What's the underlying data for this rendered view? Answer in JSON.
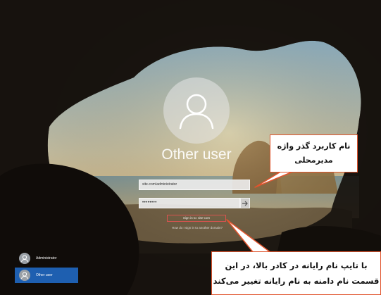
{
  "login": {
    "user_title": "Other user",
    "username_value": "site-com\\administrator",
    "password_dots": "••••••••",
    "signin_to": "Sign in to: site-com",
    "how_link": "How do I sign in to another domain?",
    "submit_icon": "arrow-right-icon",
    "accounts": [
      {
        "label": "Administrator"
      },
      {
        "label": "Other user"
      }
    ]
  },
  "callouts": {
    "top": {
      "line1": "نام کاربرد گذر واژه",
      "line2": "مدیرمحلی"
    },
    "bottom": {
      "line1": "با تایپ نام رایانه در کادر بالا، در این",
      "line2": "قسمت نام دامنه به نام رایانه تغییر می‌کند"
    }
  },
  "colors": {
    "callout_border": "#e0542d",
    "highlight_box": "#d9534f",
    "selected_account": "#1e5fb0"
  }
}
